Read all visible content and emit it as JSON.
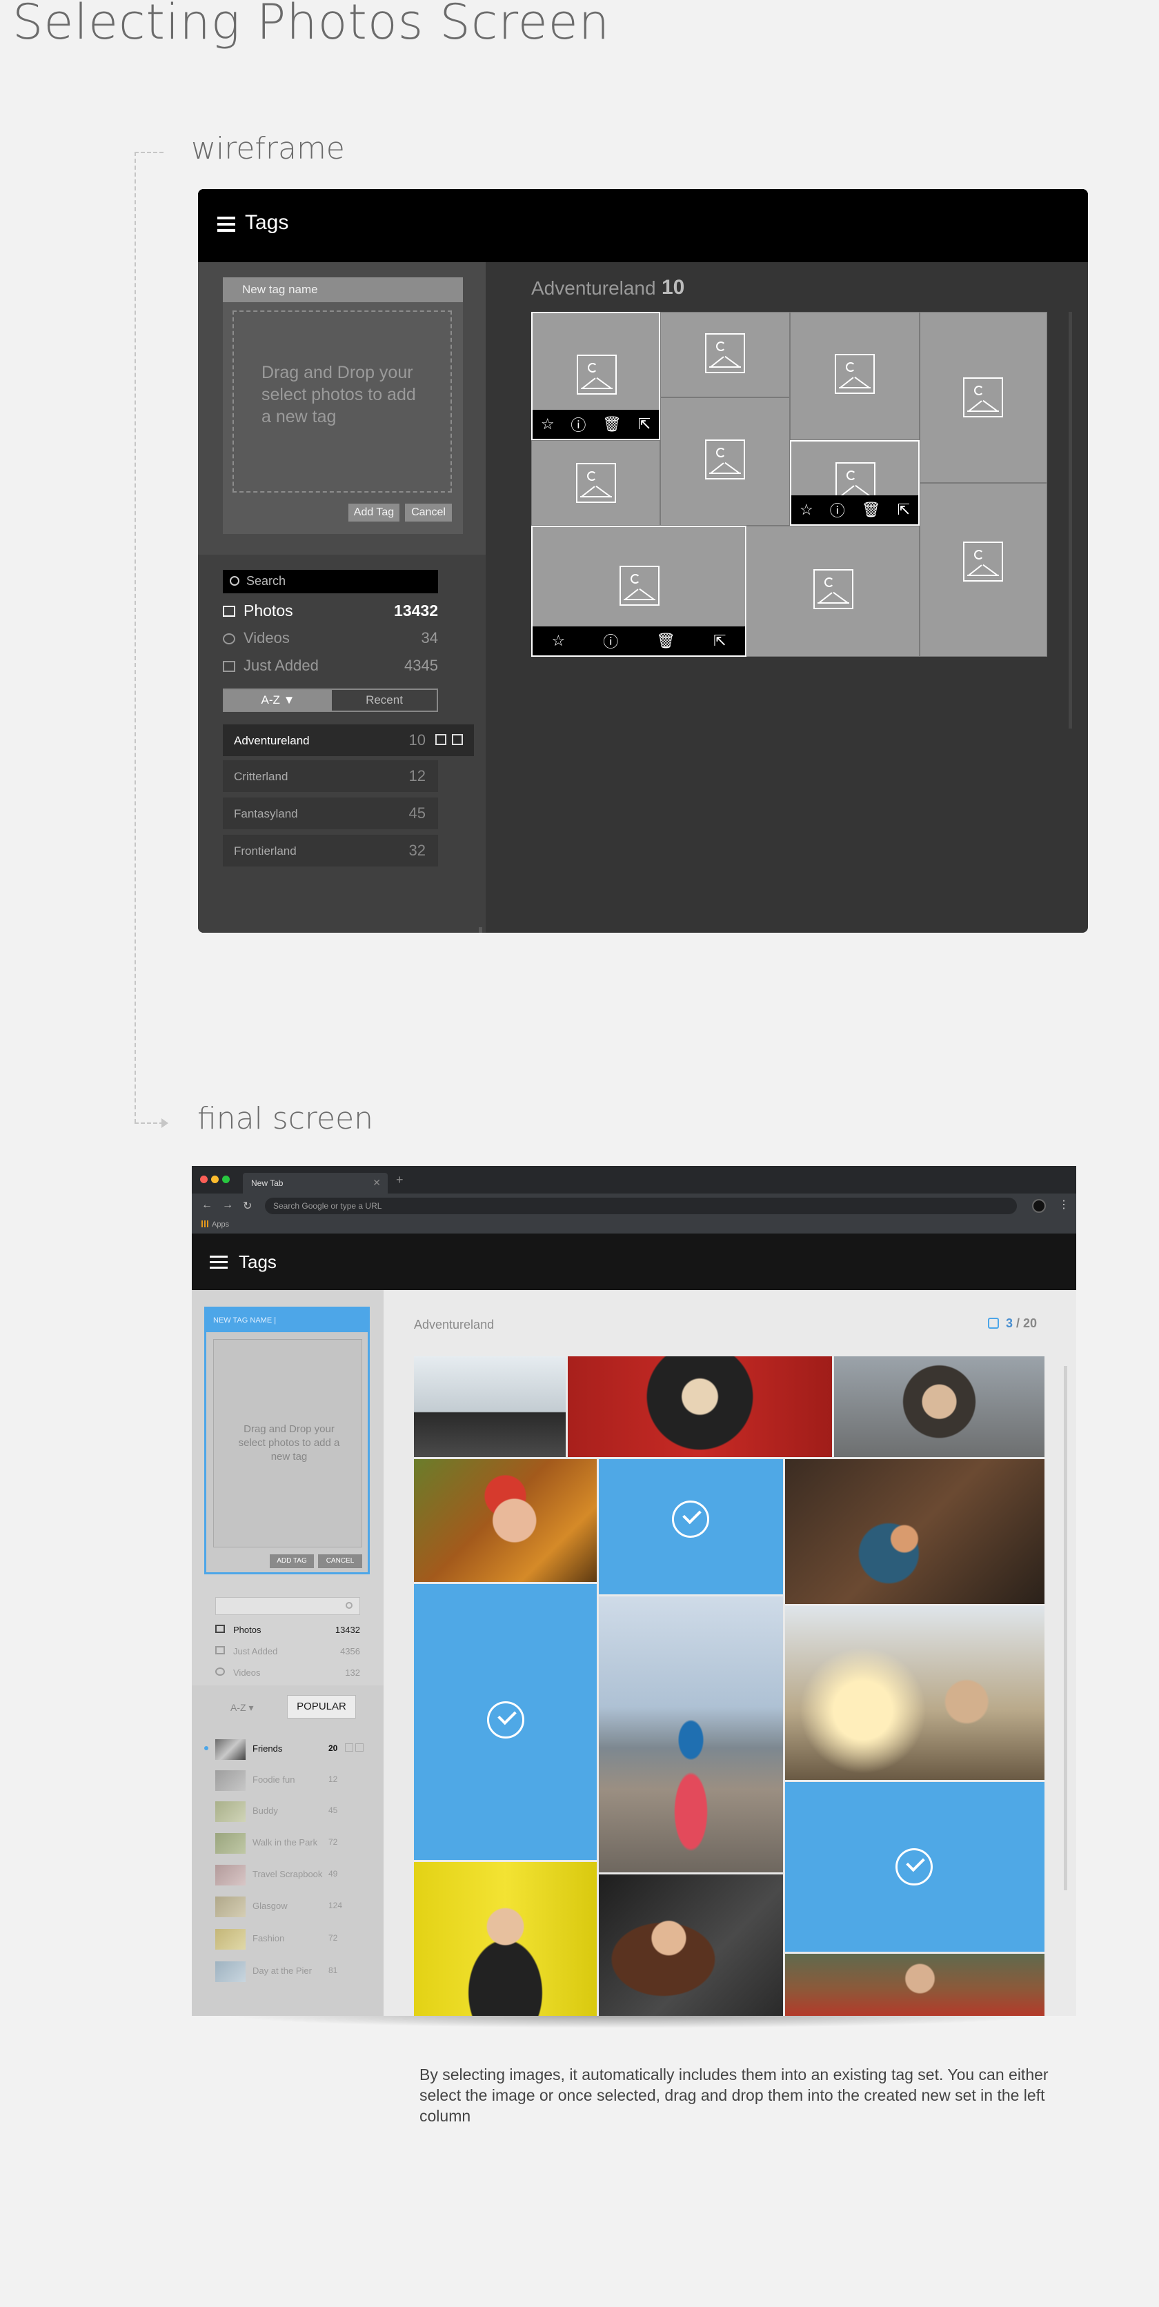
{
  "page_title": "Selecting Photos Screen",
  "section_wireframe": "wireframe",
  "section_final": "final screen",
  "wireframe": {
    "app_title": "Tags",
    "new_tag_placeholder": "New tag name",
    "drop_text": "Drag and Drop your select photos to add a new tag",
    "add_tag_label": "Add Tag",
    "cancel_label": "Cancel",
    "search_placeholder": "Search",
    "filters": [
      {
        "label": "Photos",
        "count": "13432",
        "icon": "image-icon"
      },
      {
        "label": "Videos",
        "count": "34",
        "icon": "play-icon"
      },
      {
        "label": "Just Added",
        "count": "4345",
        "icon": "image-icon"
      }
    ],
    "sort_az": "A-Z ▼",
    "sort_recent": "Recent",
    "tags": [
      {
        "label": "Adventureland",
        "count": "10"
      },
      {
        "label": "Critterland",
        "count": "12"
      },
      {
        "label": "Fantasyland",
        "count": "45"
      },
      {
        "label": "Frontierland",
        "count": "32"
      }
    ],
    "main_title": "Adventureland",
    "main_count": "10",
    "action_icons": [
      "☆",
      "ⓘ",
      "🗑",
      "⇱"
    ]
  },
  "final": {
    "browser": {
      "tab_label": "New Tab",
      "url_placeholder": "Search Google or type a URL",
      "bookmark_apps": "Apps"
    },
    "app_title": "Tags",
    "new_tag_placeholder": "NEW TAG NAME |",
    "drop_text": "Drag and Drop your select photos to add a new tag",
    "add_tag_label": "ADD TAG",
    "cancel_label": "CANCEL",
    "filters": [
      {
        "label": "Photos",
        "count": "13432",
        "icon": "image-icon"
      },
      {
        "label": "Just Added",
        "count": "4356",
        "icon": "image-icon"
      },
      {
        "label": "Videos",
        "count": "132",
        "icon": "play-icon"
      }
    ],
    "sort_az": "A-Z ▾",
    "sort_popular": "POPULAR",
    "tags": [
      {
        "label": "Friends",
        "count": "20"
      },
      {
        "label": "Foodie fun",
        "count": "12"
      },
      {
        "label": "Buddy",
        "count": "45"
      },
      {
        "label": "Walk in the Park",
        "count": "72"
      },
      {
        "label": "Travel Scrapbook",
        "count": "49"
      },
      {
        "label": "Glasgow",
        "count": "124"
      },
      {
        "label": "Fashion",
        "count": "72"
      },
      {
        "label": "Day at the Pier",
        "count": "81"
      }
    ],
    "main_title": "Adventureland",
    "selected_count": "3",
    "selected_total": "20",
    "accent_color": "#4da6e8"
  },
  "caption": "By selecting images, it automatically includes them into an existing tag set. You can either select the image or once selected, drag and drop them into the created new set in the left column"
}
